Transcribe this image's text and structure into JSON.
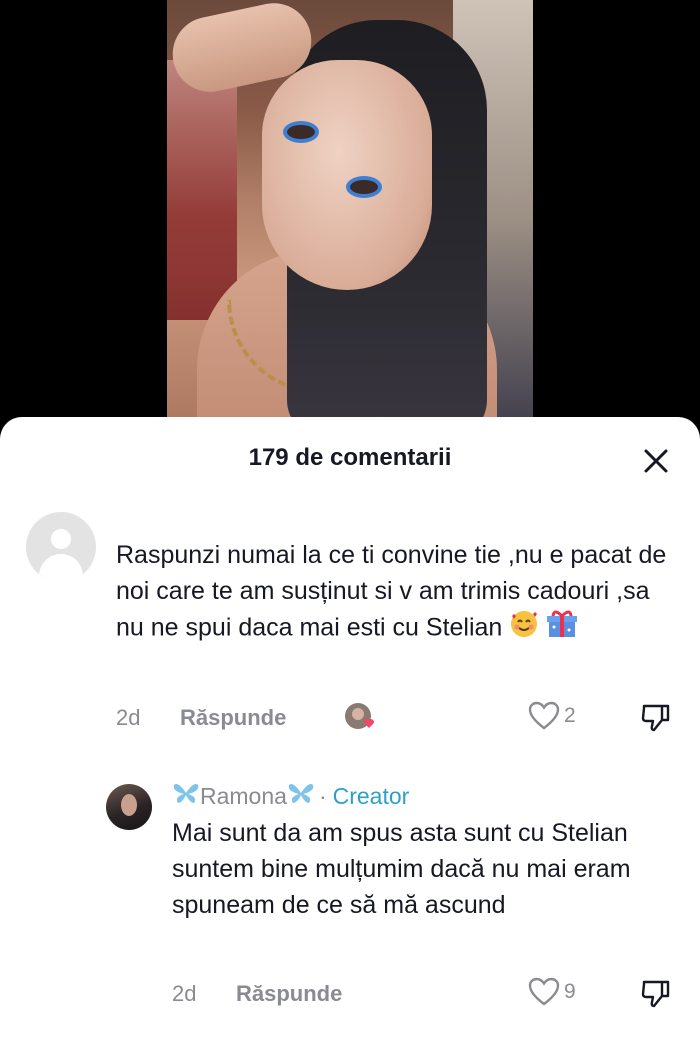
{
  "sheet": {
    "title": "179 de comentarii"
  },
  "comments": [
    {
      "text": "Raspunzi numai la ce ti convine tie ,nu e pacat de noi care te am susținut si v am trimis cadouri ,sa nu ne spui daca mai esti cu Stelian",
      "emoji": [
        "smiling-face-with-hearts",
        "gift"
      ],
      "age": "2d",
      "reply_label": "Răspunde",
      "likes": "2"
    }
  ],
  "replies": [
    {
      "username": "Ramona",
      "separator": "·",
      "badge": "Creator",
      "text": "Mai sunt da am spus asta sunt cu Stelian suntem bine mulțumim dacă nu mai eram spuneam de ce să mă ascund",
      "age": "2d",
      "reply_label": "Răspunde",
      "likes": "9"
    }
  ],
  "icons": {
    "close": "close-icon",
    "like": "heart-outline-icon",
    "dislike": "thumbs-down-icon",
    "default_avatar": "default-avatar-icon",
    "butterfly": "butterfly-icon"
  },
  "colors": {
    "creator_badge": "#2ea0c8",
    "secondary_text": "#8a8b91",
    "primary_text": "#161823"
  }
}
